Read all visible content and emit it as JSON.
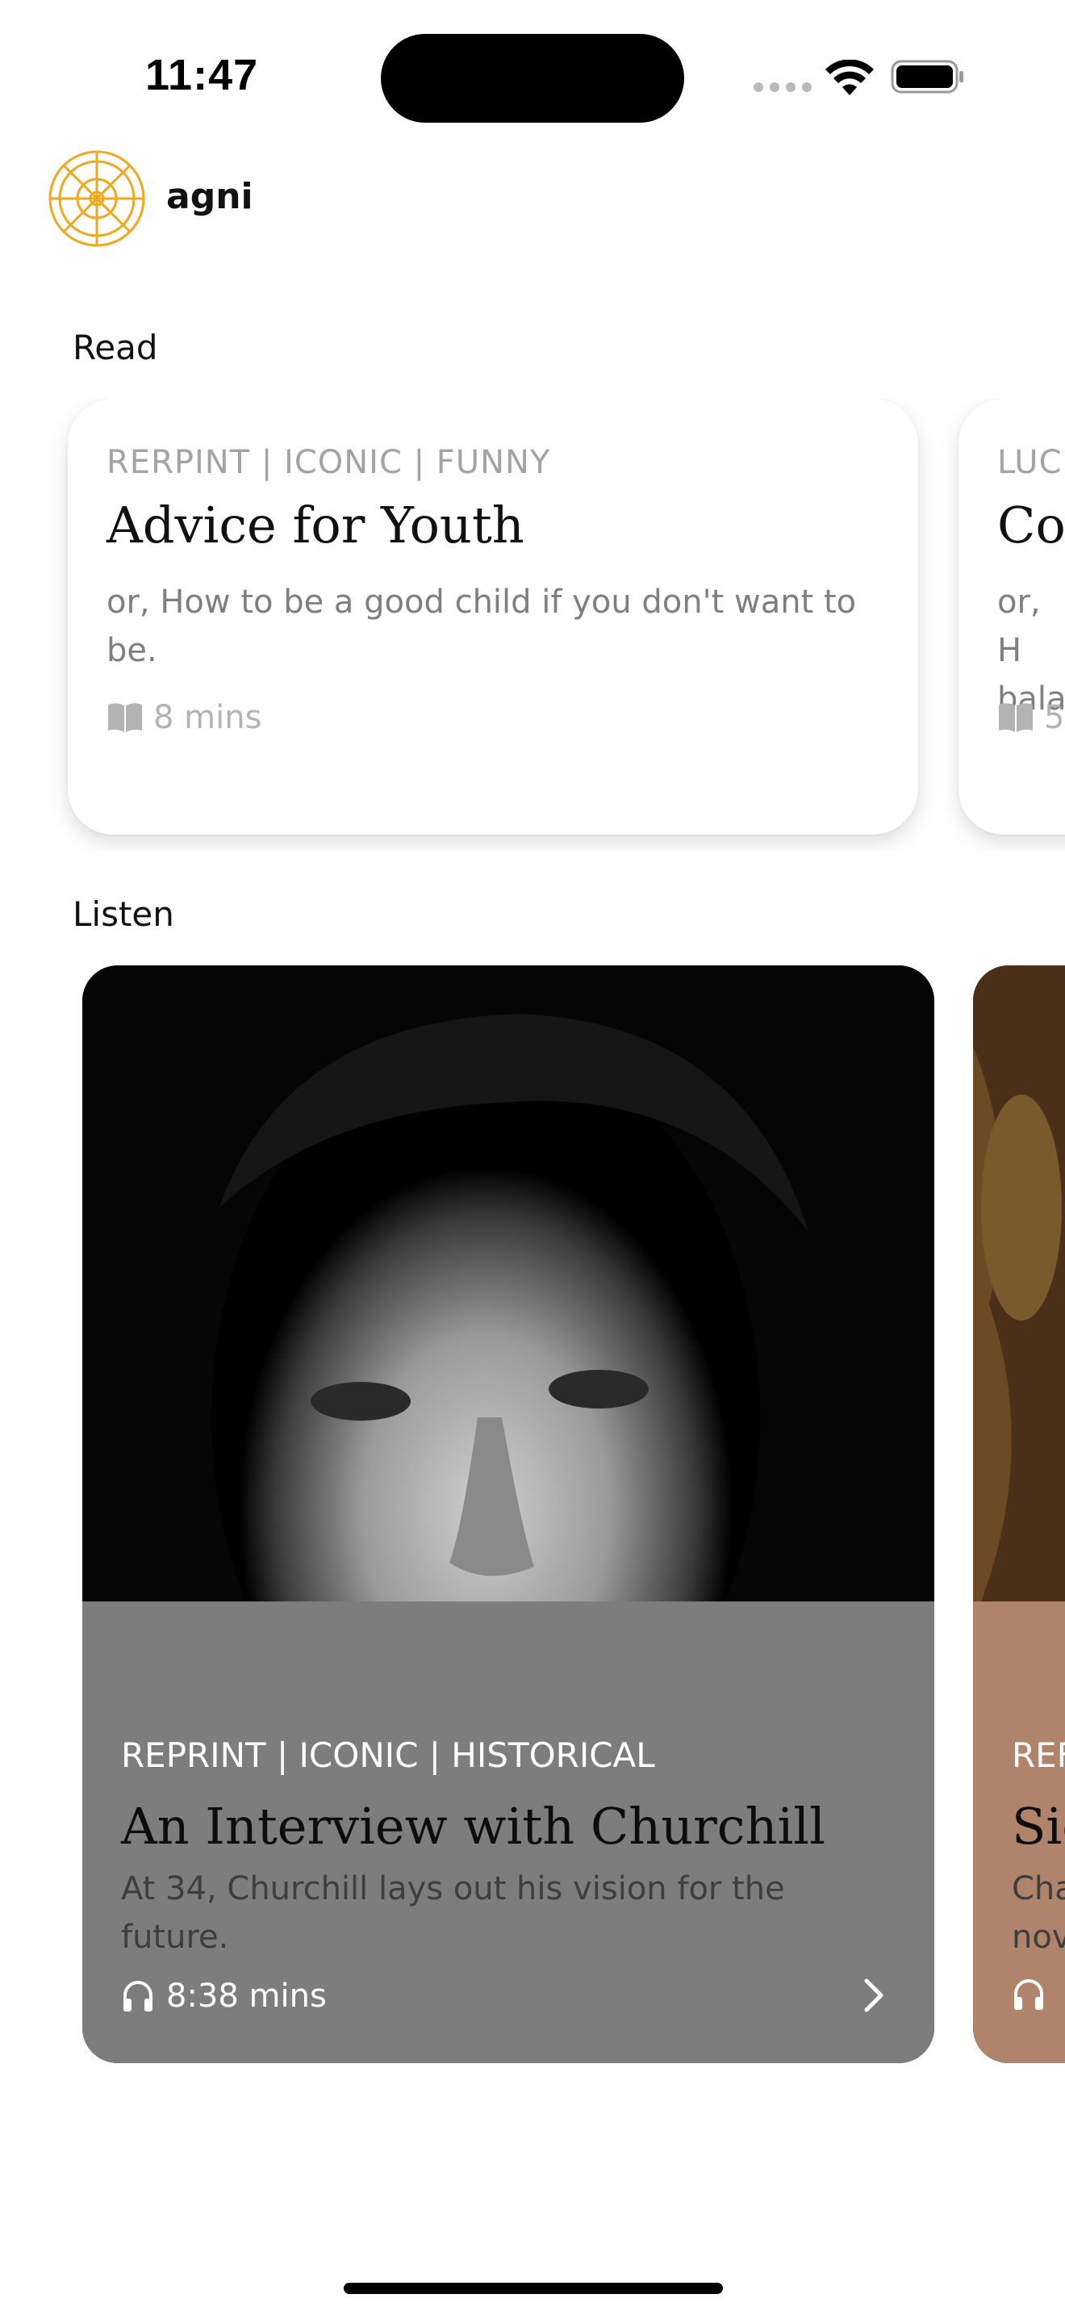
{
  "status": {
    "time": "11:47"
  },
  "header": {
    "brand": "agni"
  },
  "sections": {
    "read": "Read",
    "listen": "Listen"
  },
  "read_cards": [
    {
      "tags": "RERPINT | ICONIC | FUNNY",
      "title": "Advice for Youth",
      "subtitle": "or, How to be a good child if you don't want to be.",
      "duration": "8 mins"
    },
    {
      "tags": "LUC",
      "title": "Co",
      "subtitle": "or, H bala",
      "duration": "5"
    }
  ],
  "listen_cards": [
    {
      "tags": "REPRINT | ICONIC | HISTORICAL",
      "title": "An Interview with Churchill",
      "subtitle": "At 34, Churchill lays out his vision for the future.",
      "duration": "8:38 mins"
    },
    {
      "tags": "REF",
      "title": "Sic",
      "subtitle": "Cha nov",
      "duration": ""
    }
  ],
  "icons": {
    "logo": "wheel-logo-icon",
    "read_duration": "open-book-icon",
    "listen_duration": "headphones-icon",
    "chevron": "chevron-right-icon"
  },
  "colors": {
    "brand": "#F2A81D",
    "panel_gray": "#7D7D7D",
    "panel_warm": "#B0846A"
  }
}
